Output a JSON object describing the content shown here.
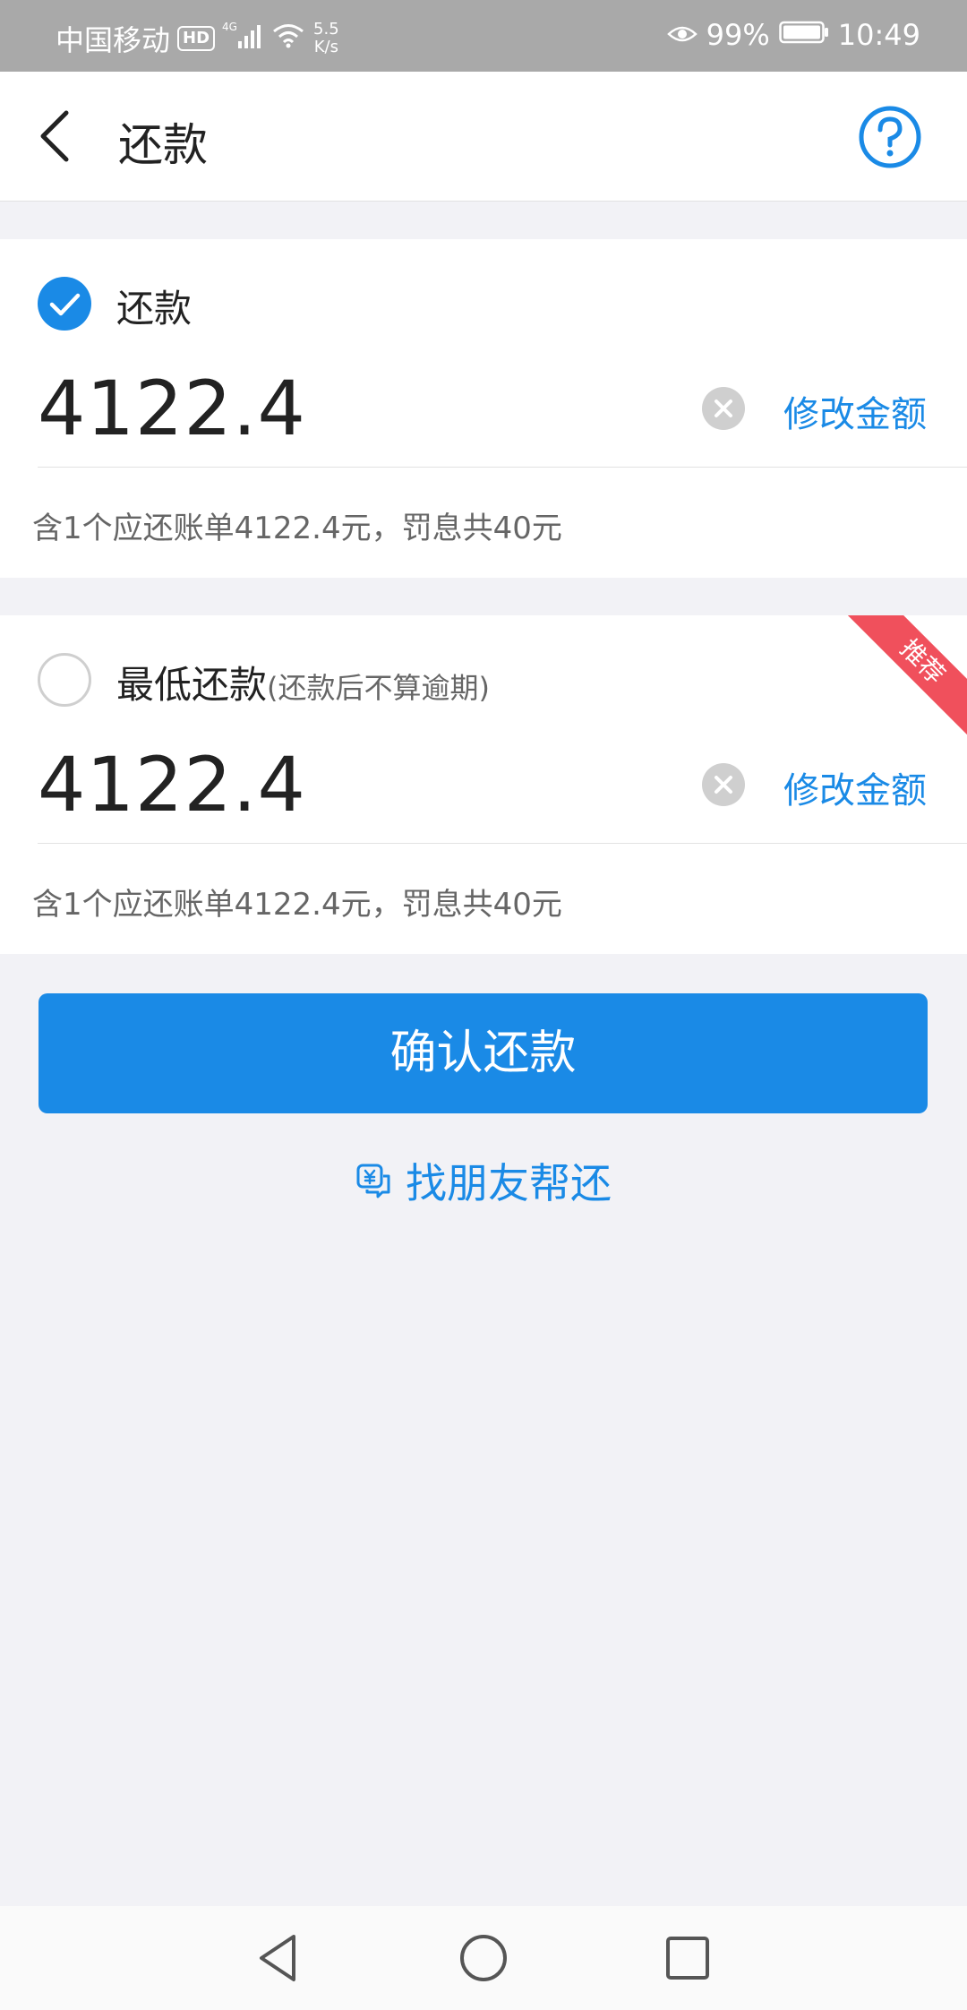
{
  "status_bar": {
    "carrier": "中国移动",
    "hd": "HD",
    "network": "4G",
    "speed_value": "5.5",
    "speed_unit": "K/s",
    "battery": "99%",
    "time": "10:49"
  },
  "header": {
    "title": "还款",
    "back_icon": "chevron-left-icon",
    "help_icon": "question-circle-icon"
  },
  "options": [
    {
      "label": "还款",
      "note": "",
      "checked": true,
      "amount": "4122.4",
      "modify_label": "修改金额",
      "bill_info": "含1个应还账单4122.4元，罚息共40元"
    },
    {
      "label": "最低还款",
      "note": "(还款后不算逾期)",
      "checked": false,
      "amount": "4122.4",
      "modify_label": "修改金额",
      "bill_info": "含1个应还账单4122.4元，罚息共40元",
      "badge": "推荐"
    }
  ],
  "confirm_button": "确认还款",
  "friend_link": "找朋友帮还",
  "colors": {
    "accent": "#1a8ae6",
    "badge": "#f0505c",
    "background": "#f2f2f6"
  }
}
